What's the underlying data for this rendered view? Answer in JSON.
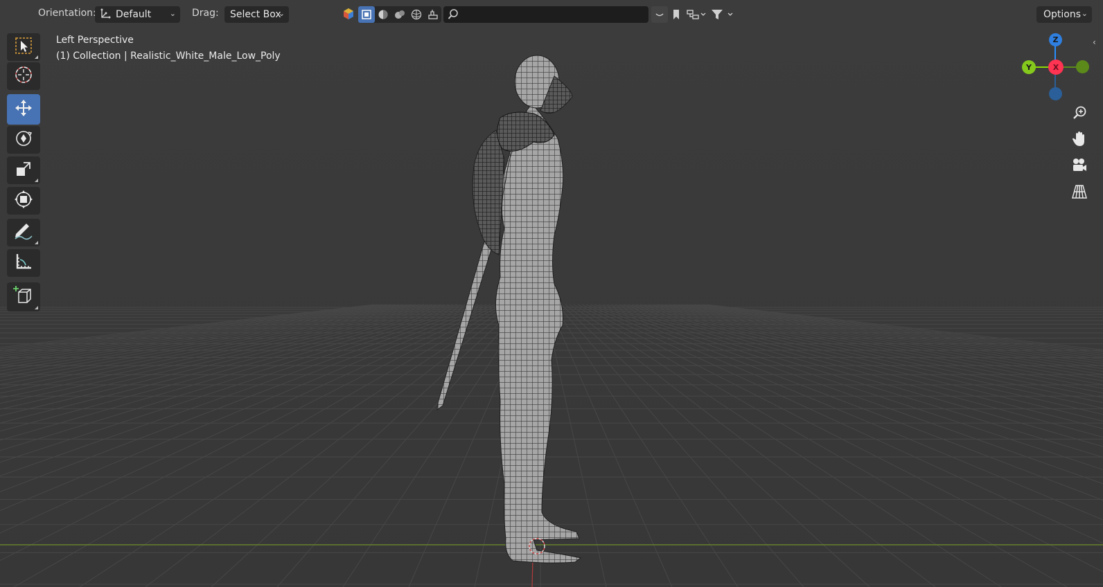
{
  "header": {
    "orientation_label": "Orientation:",
    "orientation_value": "Default",
    "drag_label": "Drag:",
    "drag_value": "Select Box",
    "options_label": "Options",
    "search_placeholder": ""
  },
  "overlay": {
    "view_name": "Left Perspective",
    "collection_info": "(1) Collection | Realistic_White_Male_Low_Poly"
  },
  "toolbar": {
    "tools": [
      {
        "name": "select-box-tool",
        "icon": "select-box-icon",
        "active": false
      },
      {
        "name": "cursor-tool",
        "icon": "cursor-icon",
        "active": false
      },
      {
        "name": "move-tool",
        "icon": "move-icon",
        "active": true
      },
      {
        "name": "rotate-tool",
        "icon": "rotate-icon",
        "active": false
      },
      {
        "name": "scale-tool",
        "icon": "scale-icon",
        "active": false
      },
      {
        "name": "transform-tool",
        "icon": "transform-icon",
        "active": false
      },
      {
        "name": "annotate-tool",
        "icon": "annotate-icon",
        "active": false
      },
      {
        "name": "measure-tool",
        "icon": "measure-icon",
        "active": false
      },
      {
        "name": "add-cube-tool",
        "icon": "add-cube-icon",
        "active": false
      }
    ]
  },
  "gizmo": {
    "z_label": "Z",
    "y_label": "Y",
    "x_label": "X",
    "colors": {
      "x": "#ff3352",
      "y": "#8bdc00",
      "z": "#2890ff"
    }
  },
  "navigation": {
    "buttons": [
      "zoom-icon",
      "pan-hand-icon",
      "camera-icon",
      "perspective-grid-icon"
    ]
  },
  "colors": {
    "background": "#3a3a3a",
    "accent": "#4772b3",
    "x_axis_line": "#c44242",
    "y_axis_line": "#7fa52a"
  }
}
